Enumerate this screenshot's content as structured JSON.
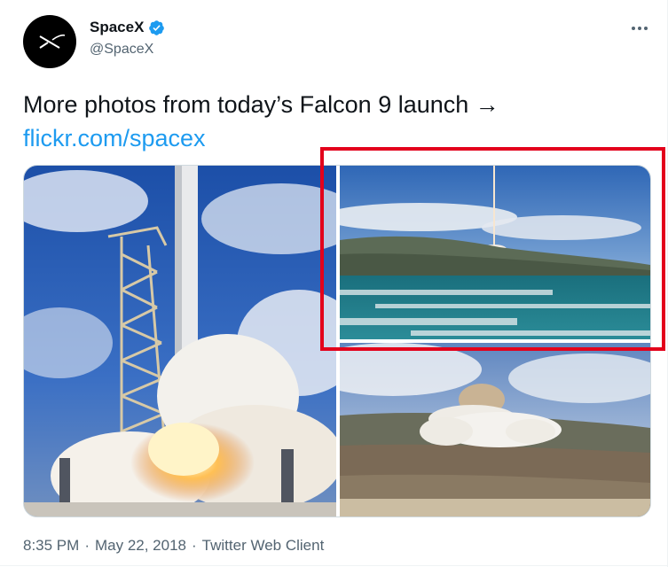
{
  "author": {
    "display_name": "SpaceX",
    "handle": "@SpaceX",
    "avatar_icon": "spacex-logo-icon",
    "verified_icon": "verified-badge-icon",
    "verified_color": "#1d9bf0"
  },
  "more_icon": "more-dots-icon",
  "tweet": {
    "text": "More photos from today’s Falcon 9 launch →",
    "link": "flickr.com/spacex"
  },
  "media": {
    "photos": [
      {
        "name": "rocket-liftoff-closeup-photo"
      },
      {
        "name": "launch-over-ocean-photo"
      },
      {
        "name": "launch-smoke-hills-photo"
      }
    ],
    "highlight_color": "#e3001b"
  },
  "meta": {
    "time": "8:35 PM",
    "sep1": "·",
    "date": "May 22, 2018",
    "sep2": "·",
    "client": "Twitter Web Client"
  },
  "colors": {
    "text": "#0f1419",
    "secondary": "#536471",
    "link": "#1d9bf0"
  }
}
